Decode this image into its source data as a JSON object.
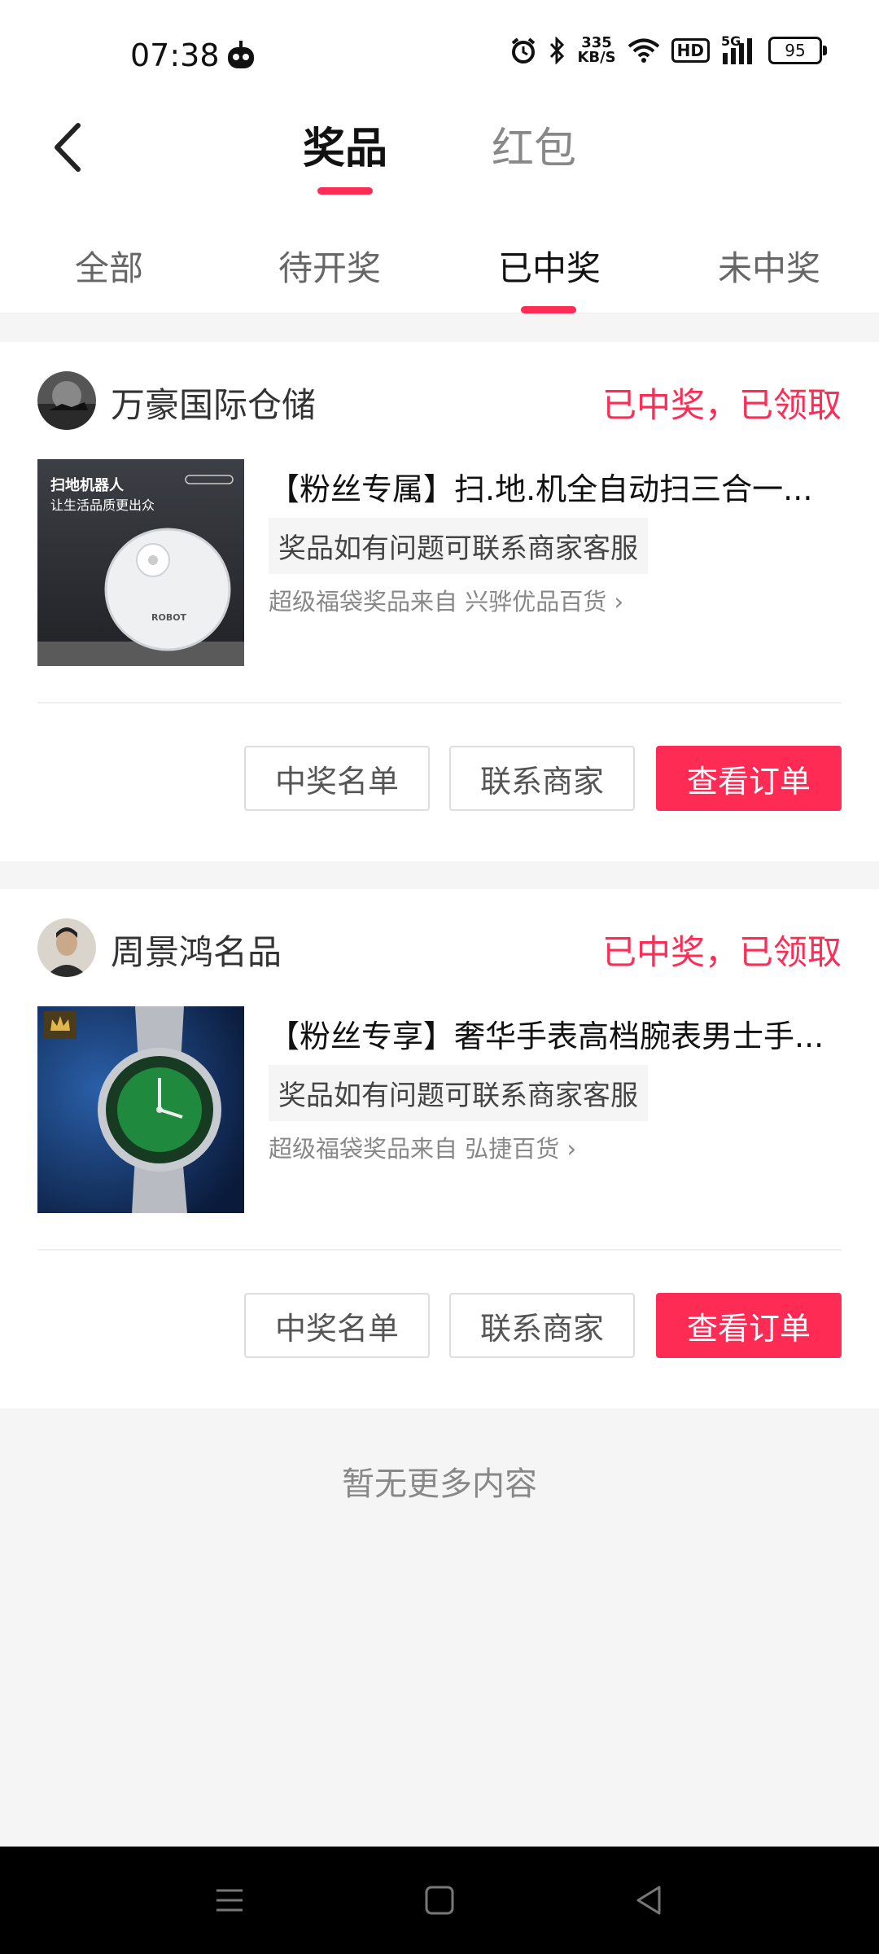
{
  "status_bar": {
    "time": "07:38",
    "net_speed_value": "335",
    "net_speed_unit": "KB/S",
    "hd_label": "HD",
    "network_type": "5G",
    "battery": "95"
  },
  "header": {
    "tabs": [
      {
        "label": "奖品",
        "active": true
      },
      {
        "label": "红包",
        "active": false
      }
    ]
  },
  "sub_tabs": [
    {
      "label": "全部",
      "active": false
    },
    {
      "label": "待开奖",
      "active": false
    },
    {
      "label": "已中奖",
      "active": true
    },
    {
      "label": "未中奖",
      "active": false
    }
  ],
  "cards": [
    {
      "shop_name": "万豪国际仓储",
      "status": "已中奖，已领取",
      "product_title": "【粉丝专属】扫.地.机全自动扫三合一...",
      "tip": "奖品如有问题可联系商家客服",
      "source_prefix": "超级福袋奖品来自",
      "source_shop": "兴骅优品百货",
      "image_text_line1": "扫地机器人",
      "image_text_line2": "让生活品质更出众",
      "image_brand": "ROBOT",
      "buttons": {
        "winners": "中奖名单",
        "contact": "联系商家",
        "order": "查看订单"
      }
    },
    {
      "shop_name": "周景鸿名品",
      "status": "已中奖，已领取",
      "product_title": "【粉丝专享】奢华手表高档腕表男士手...",
      "tip": "奖品如有问题可联系商家客服",
      "source_prefix": "超级福袋奖品来自",
      "source_shop": "弘捷百货",
      "buttons": {
        "winners": "中奖名单",
        "contact": "联系商家",
        "order": "查看订单"
      }
    }
  ],
  "footer_text": "暂无更多内容",
  "colors": {
    "accent": "#fe2c55"
  },
  "icons": [
    "back-arrow-icon",
    "alarm-icon",
    "bluetooth-icon",
    "wifi-icon",
    "signal-icon",
    "menu-icon",
    "home-icon",
    "back-triangle-icon"
  ]
}
